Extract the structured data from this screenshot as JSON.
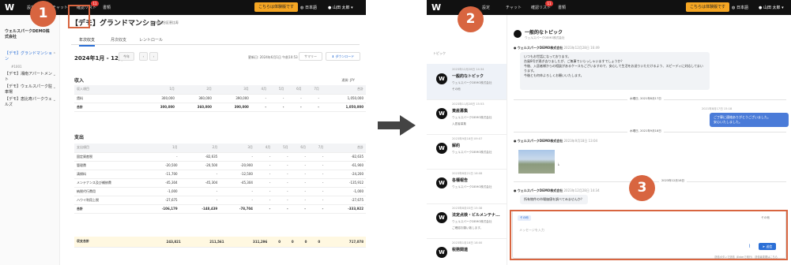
{
  "screenshot_a": {
    "topbar": {
      "nav_link": "設定",
      "chat_tab": "チャット",
      "check_list": "確認リスト",
      "check_list_badge": "11",
      "documents": "書類",
      "trial": "こちらは体験版です",
      "language": "日本語",
      "user": "山田 太郎"
    },
    "sidebar": {
      "company": "ウェルスパークDEMO株式会社",
      "items": [
        {
          "label": "【デモ】グランドマンション"
        },
        {
          "label": "#1001"
        },
        {
          "label": "【デモ】湘南アパートメント"
        },
        {
          "label": "【デモ】ウェルスパーク駐車場"
        },
        {
          "label": "【デモ】恵比寿パークウェルズ"
        }
      ]
    },
    "main": {
      "title": "【デモ】グランドマンション",
      "address": "東京都渋谷区恵比寿",
      "tabs": [
        "年次収支",
        "月次収支",
        "レントロール"
      ],
      "range": "2024年1月 - 12月",
      "year_btn": "今年",
      "prev": "‹",
      "next": "›",
      "updated": "更新日: 2024年6月1日 午前10:53",
      "summary": "サマリー",
      "download": "ダウンロード",
      "income_title": "収入",
      "unit": "通貨: JPY",
      "expense_title": "支出"
    },
    "income_table": {
      "header": [
        "収入項目",
        "1月",
        "2月",
        "3月",
        "4月",
        "5月",
        "6月",
        "7月",
        "合計"
      ],
      "rows": [
        [
          "賃料",
          "300,000",
          "360,000",
          "390,000",
          "-",
          "-",
          "-",
          "-",
          "1,050,000"
        ]
      ],
      "total": [
        "合計",
        "300,000",
        "360,000",
        "390,000",
        "-",
        "-",
        "-",
        "-",
        "1,050,000"
      ]
    },
    "expense_table": {
      "header": [
        "支出項目",
        "1月",
        "2月",
        "3月",
        "4月",
        "5月",
        "6月",
        "7月",
        "合計"
      ],
      "rows": [
        [
          "固定資産税",
          "-",
          "-82,635",
          "-",
          "-",
          "-",
          "-",
          "-",
          "-82,635"
        ],
        [
          "管理費",
          "-20,500",
          "-20,500",
          "-20,900",
          "-",
          "-",
          "-",
          "-",
          "-61,900"
        ],
        [
          "清掃料",
          "-11,700",
          "-",
          "-12,500",
          "-",
          "-",
          "-",
          "-",
          "-24,200"
        ],
        [
          "メンテナンス及び補修費",
          "-45,304",
          "-45,304",
          "-45,304",
          "-",
          "-",
          "-",
          "-",
          "-135,912"
        ],
        [
          "納税代行費用",
          "-1,000",
          "-",
          "-",
          "-",
          "-",
          "-",
          "-",
          "-1,000"
        ],
        [
          "ハウイ利用上税",
          "-27,675",
          "-",
          "-",
          "-",
          "-",
          "-",
          "-",
          "-27,675"
        ]
      ],
      "total": [
        "合計",
        "-106,179",
        "-148,439",
        "-78,704",
        "-",
        "-",
        "-",
        "-",
        "-333,922"
      ]
    },
    "grand_total": [
      "収支合計",
      "243,821",
      "211,561",
      "311,296",
      "0",
      "0",
      "0",
      "0",
      "717,078"
    ]
  },
  "screenshot_b": {
    "topbar": {
      "nav_link": "設定",
      "chat_tab": "チャット",
      "check_list": "確認リスト",
      "check_list_badge": "11",
      "documents": "書類",
      "trial": "こちらは体験版です",
      "language": "日本語",
      "user": "山田 太郎"
    },
    "topic_label": "トピック",
    "topics": [
      {
        "date": "2023年12月28日 14:34",
        "name": "一般的なトピック",
        "company": "ウェルスパークDEMO株式会社",
        "sub": "その他"
      },
      {
        "date": "2023年11月28日 15:53",
        "name": "資産募集",
        "company": "ウェルスパークDEMO株式会社",
        "sub": "入居者募集"
      },
      {
        "date": "2023年9月18日 09:07",
        "name": "解約",
        "company": "ウェルスパークDEMO株式会社",
        "sub": ""
      },
      {
        "date": "2023年8月21日 16:08",
        "name": "各種報告",
        "company": "ウェルスパークDEMO株式会社",
        "sub": ""
      },
      {
        "date": "2023年8月03日 15:38",
        "name": "法定点検・ビルメンテナ...",
        "company": "ウェルスパークDEMO株式会社",
        "sub": "ご確認お願い致します。"
      },
      {
        "date": "2023年1月18日 18:00",
        "name": "税務関連",
        "company": "",
        "sub": ""
      }
    ],
    "chat": {
      "title": "一般的なトピック",
      "subtitle": "ウェルスパークDEMO株式会社",
      "msg1_sender": "ウェルスパークDEMO株式会社",
      "msg1_time": "2023年12月28日 16:49",
      "msg1_lines": [
        "いつもお世話になっております。",
        "台風8号が過ぎ去りましたが、ご無事でいらっしゃいますでしょうか？",
        "今後、入居者様からの相談があるケースもございますので、安心して生活をお送りいただけるよう、スピーディに対応してまいります。",
        "今後とも何卒よろしくお願いいたします。"
      ],
      "day1": "水曜日, 2021年8月17日",
      "mine_time": "2021年8月17日 15:18",
      "mine_text": [
        "ご丁寧に連絡ありがとうございました。",
        "安心いたしました。"
      ],
      "day2": "水曜日, 2021年9月18日",
      "msg2_sender": "ウェルスパークDEMO株式会社",
      "msg2_time": "2023年9月18日 13:04",
      "day3": "2023年12月18日",
      "msg3_sender": "ウェルスパークDEMO株式会社",
      "msg3_time": "2023年12月28日 14:34",
      "msg3_text": "所有物件の市場価値を調べてみませんか？"
    },
    "composer": {
      "tag": "その他",
      "select": "その他",
      "placeholder": "メッセージを入力",
      "send": "送信",
      "hint": "送信ボタンで送信（Enterで改行） 送信者変更はこちら"
    }
  },
  "callouts": [
    "1",
    "2",
    "3"
  ],
  "colors": {
    "accent": "#2b6fd6",
    "callout": "#d86540",
    "topbar": "#111111",
    "trial": "#f5a623"
  }
}
